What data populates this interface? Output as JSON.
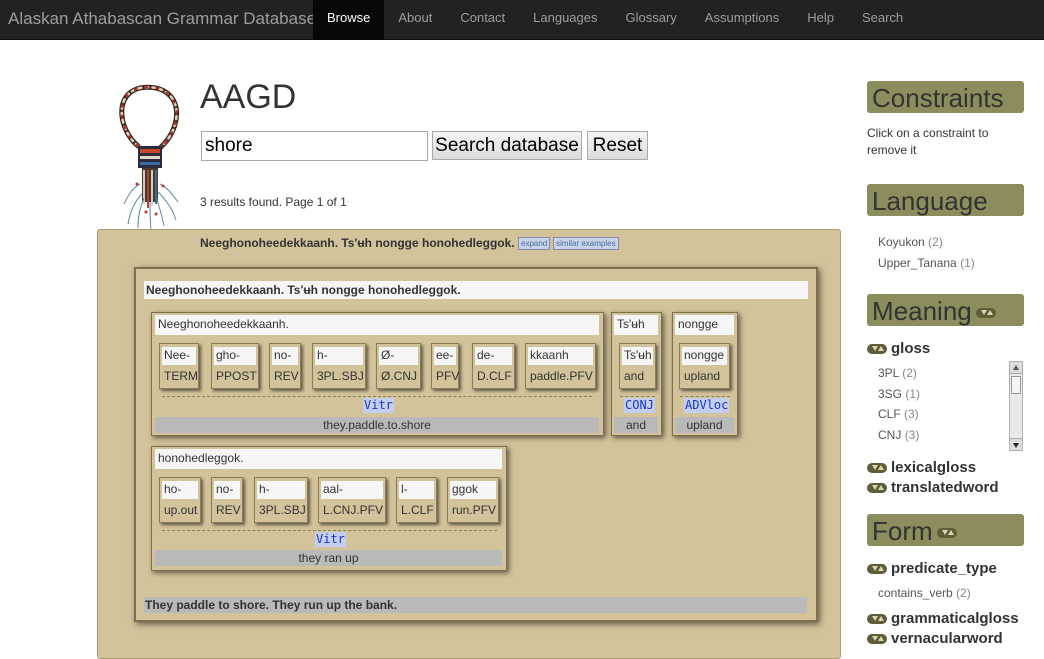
{
  "navbar": {
    "brand": "Alaskan Athabascan Grammar Database",
    "items": [
      "Browse",
      "About",
      "Contact",
      "Languages",
      "Glossary",
      "Assumptions",
      "Help",
      "Search"
    ]
  },
  "header": {
    "title": "AAGD",
    "search_value": "shore",
    "search_button": "Search database",
    "reset_button": "Reset",
    "results_text": "3 results found. Page 1 of 1"
  },
  "result": {
    "sentence": "Neeghonoheedekkaanh. Ts'ʉh nongge honohedleggok.",
    "expand_label": "expand",
    "similar_label": "similar examples",
    "igt_title": "Neeghonoheedekkaanh. Ts'ʉh nongge honohedleggok.",
    "free_translation": "They paddle to shore. They run up the bank.",
    "words": [
      {
        "form": "Neeghonoheedekkaanh.",
        "pos": "Vitr",
        "gloss": "they.paddle.to.shore",
        "morphemes": [
          {
            "form": "Nee-",
            "gloss": "TERM"
          },
          {
            "form": "gho-",
            "gloss": "PPOST"
          },
          {
            "form": "no-",
            "gloss": "REV"
          },
          {
            "form": "h-",
            "gloss": "3PL.SBJ"
          },
          {
            "form": "Ø-",
            "gloss": "Ø.CNJ"
          },
          {
            "form": "ee-",
            "gloss": "PFV"
          },
          {
            "form": "de-",
            "gloss": "D.CLF"
          },
          {
            "form": "kkaanh",
            "gloss": "paddle.PFV"
          }
        ]
      },
      {
        "form": "Ts'ʉh",
        "pos": "CONJ",
        "gloss": "and",
        "morphemes": [
          {
            "form": "Ts'ʉh",
            "gloss": "and"
          }
        ]
      },
      {
        "form": "nongge",
        "pos": "ADVloc",
        "gloss": "upland",
        "morphemes": [
          {
            "form": "nongge",
            "gloss": "upland"
          }
        ]
      },
      {
        "form": "honohedleggok.",
        "pos": "Vitr",
        "gloss": "they ran up",
        "morphemes": [
          {
            "form": "ho-",
            "gloss": "up.out"
          },
          {
            "form": "no-",
            "gloss": "REV"
          },
          {
            "form": "h-",
            "gloss": "3PL.SBJ"
          },
          {
            "form": "aal-",
            "gloss": "L.CNJ.PFV"
          },
          {
            "form": "l-",
            "gloss": "L.CLF"
          },
          {
            "form": "ggok",
            "gloss": "run.PFV"
          }
        ]
      }
    ]
  },
  "sidebar": {
    "constraints_title": "Constraints",
    "constraints_help": "Click on a constraint to remove it",
    "language_title": "Language",
    "languages": [
      {
        "name": "Koyukon",
        "count": "(2)"
      },
      {
        "name": "Upper_Tanana",
        "count": "(1)"
      }
    ],
    "meaning_title": "Meaning",
    "gloss_label": "gloss",
    "gloss_items": [
      {
        "name": "3PL",
        "count": "(2)"
      },
      {
        "name": "3SG",
        "count": "(1)"
      },
      {
        "name": "CLF",
        "count": "(3)"
      },
      {
        "name": "CNJ",
        "count": "(3)"
      }
    ],
    "lexicalgloss_label": "lexicalgloss",
    "translatedword_label": "translatedword",
    "form_title": "Form",
    "predicate_type_label": "predicate_type",
    "predicate_items": [
      {
        "name": "contains_verb",
        "count": "(2)"
      }
    ],
    "grammaticalgloss_label": "grammaticalgloss",
    "vernacularword_label": "vernacularword"
  },
  "colors": {
    "panel": "#d3c39a",
    "sidebar_head": "#8d8c5d",
    "navbar": "#222222",
    "pos_tag": "#1a36c9"
  }
}
